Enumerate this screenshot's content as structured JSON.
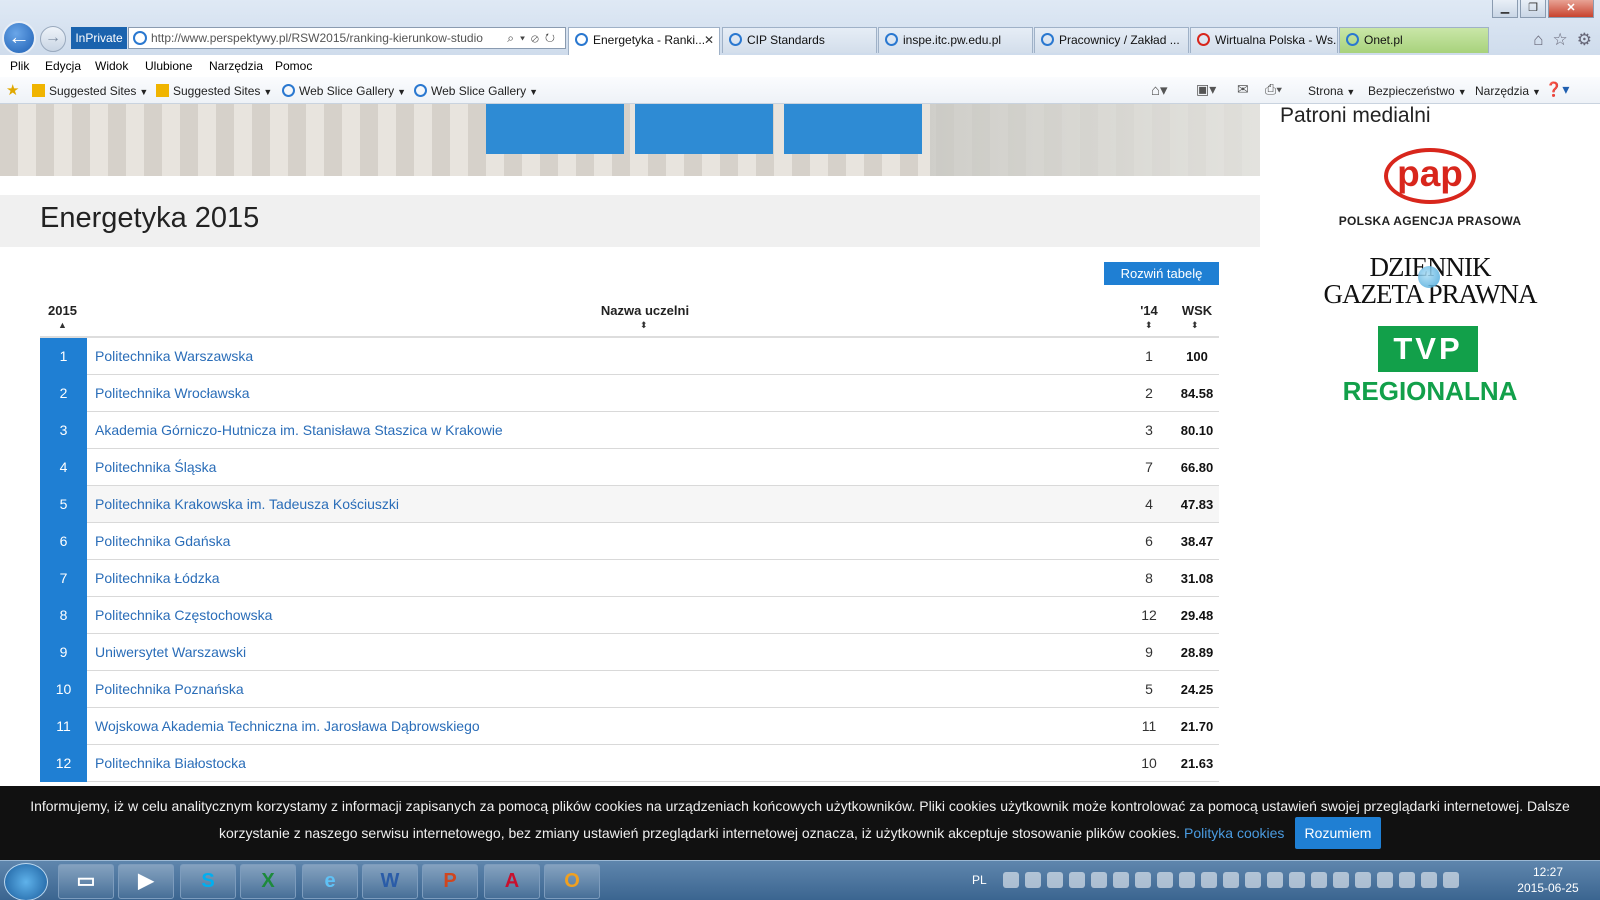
{
  "browser": {
    "inprivate_label": "InPrivate",
    "address_url": "http://www.perspektywy.pl/RSW2015/ranking-kierunkow-studio",
    "tabs": [
      {
        "label": "Energetyka - Ranki...",
        "active": true
      },
      {
        "label": "CIP Standards"
      },
      {
        "label": "inspe.itc.pw.edu.pl"
      },
      {
        "label": "Pracownicy / Zakład ..."
      },
      {
        "label": "Wirtualna Polska - Ws..."
      },
      {
        "label": "Onet.pl"
      }
    ],
    "menu": [
      "Plik",
      "Edycja",
      "Widok",
      "Ulubione",
      "Narzędzia",
      "Pomoc"
    ],
    "favorites": [
      "Suggested Sites",
      "Suggested Sites",
      "Web Slice Gallery",
      "Web Slice Gallery"
    ],
    "commandbar": [
      "Strona",
      "Bezpieczeństwo",
      "Narzędzia"
    ]
  },
  "page": {
    "title": "Energetyka 2015",
    "expand_button": "Rozwiń tabelę",
    "columns": {
      "rank": "2015",
      "name": "Nazwa uczelni",
      "prev": "'14",
      "wsk": "WSK"
    },
    "rows": [
      {
        "rank": "1",
        "name": "Politechnika Warszawska",
        "prev": "1",
        "wsk": "100"
      },
      {
        "rank": "2",
        "name": "Politechnika Wrocławska",
        "prev": "2",
        "wsk": "84.58"
      },
      {
        "rank": "3",
        "name": "Akademia Górniczo-Hutnicza im. Stanisława Staszica w Krakowie",
        "prev": "3",
        "wsk": "80.10"
      },
      {
        "rank": "4",
        "name": "Politechnika Śląska",
        "prev": "7",
        "wsk": "66.80"
      },
      {
        "rank": "5",
        "name": "Politechnika Krakowska im. Tadeusza Kościuszki",
        "prev": "4",
        "wsk": "47.83"
      },
      {
        "rank": "6",
        "name": "Politechnika Gdańska",
        "prev": "6",
        "wsk": "38.47"
      },
      {
        "rank": "7",
        "name": "Politechnika Łódzka",
        "prev": "8",
        "wsk": "31.08"
      },
      {
        "rank": "8",
        "name": "Politechnika Częstochowska",
        "prev": "12",
        "wsk": "29.48"
      },
      {
        "rank": "9",
        "name": "Uniwersytet Warszawski",
        "prev": "9",
        "wsk": "28.89"
      },
      {
        "rank": "10",
        "name": "Politechnika Poznańska",
        "prev": "5",
        "wsk": "24.25"
      },
      {
        "rank": "11",
        "name": "Wojskowa Akademia Techniczna im. Jarosława Dąbrowskiego",
        "prev": "11",
        "wsk": "21.70"
      },
      {
        "rank": "12",
        "name": "Politechnika Białostocka",
        "prev": "10",
        "wsk": "21.63"
      }
    ]
  },
  "sidebar": {
    "title": "Patroni medialni",
    "pap_logo": "pap",
    "pap_sub": "POLSKA AGENCJA PRASOWA",
    "dgp_line1": "DZIENNIK",
    "dgp_line2": "GAZETA PRAWNA",
    "tvp_logo": "TVP",
    "tvp_sub": "REGIONALNA"
  },
  "cookie": {
    "line1": "Informujemy, iż w celu analitycznym korzystamy z informacji zapisanych za pomocą plików cookies na urządzeniach końcowych użytkowników. Pliki cookies użytkownik może kontrolować za pomocą ustawień swojej przeglądarki internetowej. Dalsze",
    "line2": "korzystanie z naszego serwisu internetowego, bez zmiany ustawień przeglądarki internetowej oznacza, iż użytkownik akceptuje stosowanie plików cookies.",
    "link": "Polityka cookies",
    "button": "Rozumiem"
  },
  "taskbar": {
    "lang": "PL",
    "time": "12:27",
    "date": "2015-06-25",
    "apps": [
      "explorer-icon",
      "media-player-icon",
      "skype-icon",
      "excel-icon",
      "ie-icon",
      "word-icon",
      "powerpoint-icon",
      "acrobat-icon",
      "outlook-icon"
    ]
  }
}
